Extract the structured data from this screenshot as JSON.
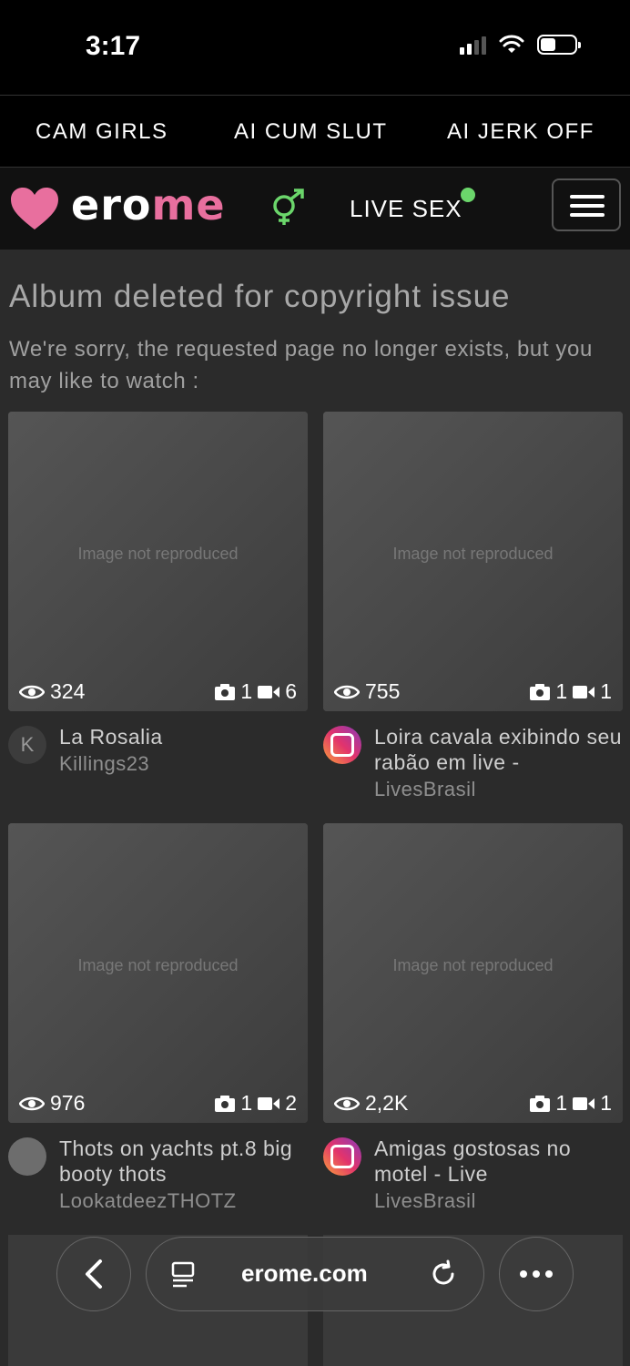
{
  "status_bar": {
    "time": "3:17"
  },
  "top_links": [
    "CAM GIRLS",
    "AI CUM SLUT",
    "AI JERK OFF"
  ],
  "navbar": {
    "brand_prefix": "ero",
    "brand_suffix": "me",
    "live_label": "LIVE SEX",
    "colors": {
      "brand_pink": "#e86f9e",
      "live_dot": "#6bd66b",
      "gender_icon": "#6bd66b"
    }
  },
  "page": {
    "heading": "Album deleted for copyright issue",
    "subheading": "We're sorry, the requested page no longer exists, but you may like to watch :"
  },
  "placeholder_label": "Image not reproduced",
  "cards": [
    {
      "views": "324",
      "photos": "1",
      "videos": "6",
      "title": "La Rosalia",
      "user": "Killings23",
      "avatar": "K"
    },
    {
      "views": "755",
      "photos": "1",
      "videos": "1",
      "title": "Loira cavala exibindo seu rabão em live -",
      "user": "LivesBrasil",
      "avatar": "instagram-icon"
    },
    {
      "views": "976",
      "photos": "1",
      "videos": "2",
      "title": "Thots on yachts pt.8 big booty thots",
      "user": "LookatdeezTHOTZ",
      "avatar": "photo"
    },
    {
      "views": "2,2K",
      "photos": "1",
      "videos": "1",
      "title": "Amigas gostosas no motel - Live",
      "user": "LivesBrasil",
      "avatar": "instagram-icon"
    }
  ],
  "browser_bar": {
    "url": "erome.com"
  }
}
